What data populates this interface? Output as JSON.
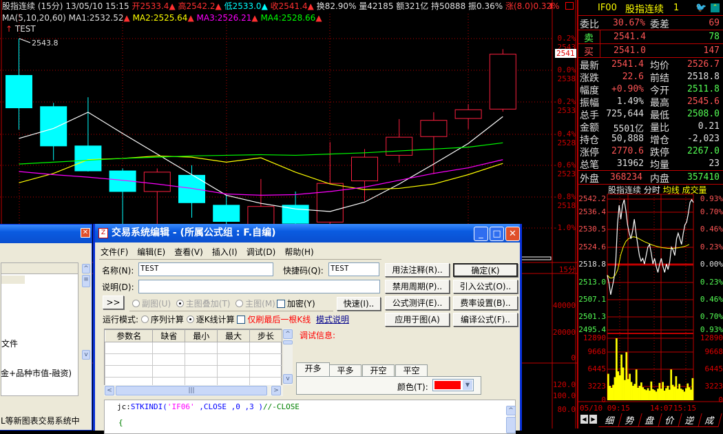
{
  "header": {
    "instrument": "股指连续",
    "period": "(15分)",
    "datetime": "13/05/10 15:15",
    "open": "开2533.4",
    "high": "高2542.2",
    "low": "低2533.0",
    "close": "收2541.4",
    "turnover": "换82.90%",
    "volume": "量42185",
    "amount": "额321亿",
    "open_interest": "持50888",
    "amplitude": "振0.36%",
    "change": "涨(8.0)0.32%"
  },
  "ma": {
    "label": "MA(5,10,20,60)",
    "ma1": "MA1:2532.52",
    "ma2": "MA2:2525.64",
    "ma3": "MA3:2526.21",
    "ma4": "MA4:2528.66"
  },
  "indicator_label": "TEST",
  "high_marker": "2543.8",
  "price_axis": [
    {
      "pct": "0.2%",
      "price": "2543"
    },
    {
      "pct": "0.0%",
      "price": "2538"
    },
    {
      "pct": "-0.2%",
      "price": "2533"
    },
    {
      "pct": "-0.4%",
      "price": "2528"
    },
    {
      "pct": "-0.6%",
      "price": "2523"
    },
    {
      "pct": "-0.8%",
      "price": "2518"
    },
    {
      "pct": "-1.0%",
      "price": ""
    }
  ],
  "current_price_tag": "2541",
  "period_label": "15分",
  "volume_axis": [
    "40000",
    "20000",
    "0"
  ],
  "sub_axis": [
    "120.0",
    "100.0",
    "80.0"
  ],
  "colors": {
    "up": "#ff2040",
    "down": "#00ffff",
    "ma1": "#ffffff",
    "ma2": "#ffff00",
    "ma3": "#ff00ff",
    "ma4": "#00ff00",
    "grid": "#c00000"
  },
  "chart_data": {
    "type": "candlestick",
    "candles": [
      {
        "o": 2537.9,
        "h": 2543.8,
        "l": 2529.2,
        "c": 2532.7
      },
      {
        "o": 2532.9,
        "h": 2533.5,
        "l": 2524.3,
        "c": 2526.6
      },
      {
        "o": 2526.6,
        "h": 2534.4,
        "l": 2522.5,
        "c": 2522.6
      },
      {
        "o": 2522.6,
        "h": 2523.0,
        "l": 2512.0,
        "c": 2519.3
      },
      {
        "o": 2519.3,
        "h": 2523.0,
        "l": 2512.0,
        "c": 2522.4
      },
      {
        "o": 2521.9,
        "h": 2523.5,
        "l": 2515.1,
        "c": 2517.5
      },
      {
        "o": 2517.1,
        "h": 2518.7,
        "l": 2512.0,
        "c": 2514.5
      },
      {
        "o": 2514.0,
        "h": 2521.3,
        "l": 2512.0,
        "c": 2516.9
      },
      {
        "o": 2517.1,
        "h": 2519.3,
        "l": 2513.0,
        "c": 2514.2
      },
      {
        "o": 2514.4,
        "h": 2527.2,
        "l": 2512.0,
        "c": 2520.6
      },
      {
        "o": 2521.0,
        "h": 2526.1,
        "l": 2517.8,
        "c": 2524.8
      },
      {
        "o": 2525.1,
        "h": 2530.9,
        "l": 2523.9,
        "c": 2528.0
      },
      {
        "o": 2528.1,
        "h": 2532.0,
        "l": 2522.1,
        "c": 2530.7
      },
      {
        "o": 2531.0,
        "h": 2533.3,
        "l": 2529.3,
        "c": 2532.4
      },
      {
        "o": 2532.5,
        "h": 2542.1,
        "l": 2532.1,
        "c": 2541.3
      }
    ],
    "ma1": [
      2527.8,
      2529.4,
      2532.0,
      2528.6,
      2525.3,
      2522.0,
      2518.7,
      2517.4,
      2516.5,
      2516.1,
      2517.6,
      2520.5,
      2523.7,
      2527.0,
      2531.3
    ],
    "ma2": [
      2520.7,
      2522.2,
      2524.4,
      2524.6,
      2525.0,
      2524.8,
      2524.0,
      2524.7,
      2522.4,
      2520.5,
      2519.6,
      2519.8,
      2520.5,
      2522.0,
      2523.8
    ],
    "ma3": [
      2522.5,
      2522.0,
      2521.6,
      2521.1,
      2520.5,
      2519.8,
      2518.9,
      2518.7,
      2518.8,
      2519.3,
      2520.0,
      2521.1,
      2522.2,
      2523.1,
      2524.4
    ],
    "ma4": [
      2523.7,
      2524.0,
      2524.3,
      2524.6,
      2524.8,
      2525.0,
      2525.1,
      2525.2,
      2525.1,
      2525.3,
      2525.5,
      2525.8,
      2526.1,
      2526.4,
      2527.1
    ]
  },
  "quote": {
    "code": "IF00",
    "name": "股指连续",
    "num": "1",
    "wb_label": "委比",
    "wb": "30.67%",
    "wc_label": "委差",
    "wc": "69",
    "sell_label": "卖",
    "sell_price": "2541.4",
    "sell_vol": "78",
    "buy_label": "买",
    "buy_price": "2541.0",
    "buy_vol": "147",
    "rows": [
      {
        "l1": "最新",
        "v1": "2541.4",
        "c1": "#ff5555",
        "l2": "均价",
        "v2": "2526.7",
        "c2": "#ff5555"
      },
      {
        "l1": "涨跌",
        "v1": "22.6",
        "c1": "#ff5555",
        "l2": "前结",
        "v2": "2518.8",
        "c2": "#e0e0e0"
      },
      {
        "l1": "幅度",
        "v1": "+0.90%",
        "c1": "#ff5555",
        "l2": "今开",
        "v2": "2511.8",
        "c2": "#55ff55"
      },
      {
        "l1": "振幅",
        "v1": "1.49%",
        "c1": "#e0e0e0",
        "l2": "最高",
        "v2": "2545.6",
        "c2": "#ff5555"
      },
      {
        "l1": "总手",
        "v1": "725,644",
        "c1": "#e0e0e0",
        "l2": "最低",
        "v2": "2508.0",
        "c2": "#55ff55"
      },
      {
        "l1": "金额",
        "v1": "5501亿",
        "c1": "#e0e0e0",
        "l2": "量比",
        "v2": "0.21",
        "c2": "#e0e0e0"
      },
      {
        "l1": "持仓",
        "v1": "50,888",
        "c1": "#e0e0e0",
        "l2": "增仓",
        "v2": "-2,023",
        "c2": "#e0e0e0"
      },
      {
        "l1": "涨停",
        "v1": "2770.6",
        "c1": "#ff5555",
        "l2": "跌停",
        "v2": "2267.0",
        "c2": "#55ff55"
      },
      {
        "l1": "总笔",
        "v1": "31962",
        "c1": "#e0e0e0",
        "l2": "均量",
        "v2": "23",
        "c2": "#e0e0e0"
      }
    ],
    "outer_label": "外盘",
    "outer": "368234",
    "inner_label": "内盘",
    "inner": "357410"
  },
  "mini": {
    "title": "股指连续",
    "t1": "分时",
    "t2": "均线",
    "t3": "成交量",
    "left_axis": [
      "2542.2",
      "2536.4",
      "2530.5",
      "2524.6",
      "2518.8",
      "2513.0",
      "2507.1",
      "2501.3",
      "2495.4"
    ],
    "right_axis": [
      "0.93%",
      "0.70%",
      "0.46%",
      "0.23%",
      "0.00%",
      "0.23%",
      "0.46%",
      "0.70%",
      "0.93%"
    ],
    "vol_axis": [
      "12890",
      "9668",
      "6445",
      "3223",
      "0"
    ],
    "time_start": "05/10 09:15",
    "time_mid": "14:07",
    "time_end": "15:15",
    "tabs": [
      "细",
      "势",
      "盘",
      "价",
      "逆",
      "成"
    ],
    "chart_data": {
      "type": "line",
      "price": [
        2515,
        2512,
        2508,
        2511,
        2514,
        2520,
        2533,
        2540,
        2535,
        2540,
        2542,
        2538,
        2533,
        2530,
        2528,
        2531,
        2535,
        2530,
        2526,
        2522,
        2520,
        2521,
        2519,
        2522,
        2525,
        2526,
        2523,
        2519,
        2521,
        2518,
        2516,
        2519,
        2521,
        2518,
        2516,
        2519,
        2517,
        2520,
        2525,
        2524,
        2522,
        2528,
        2530,
        2528,
        2526,
        2530,
        2533,
        2534,
        2537,
        2541,
        2542,
        2541
      ],
      "avg": [
        2515,
        2514,
        2514,
        2515,
        2517,
        2522,
        2525,
        2527,
        2528,
        2528.5,
        2528.7,
        2528.5,
        2528,
        2527.5,
        2527,
        2526.6,
        2526.2,
        2525.8,
        2525.5,
        2525.2,
        2525,
        2524.8,
        2524.7,
        2524.6,
        2524.6,
        2524.6,
        2524.7,
        2524.8,
        2525,
        2525.2,
        2525.5,
        2526
      ],
      "volume": [
        5500,
        3000,
        2600,
        3200,
        4800,
        12890,
        6000,
        5200,
        9500,
        6800,
        4200,
        10000,
        4400,
        5500,
        3800,
        3000,
        3400,
        6400,
        2600,
        3000,
        3700,
        2700,
        2300,
        2100,
        2500,
        2000,
        3900,
        2300,
        2100,
        1800,
        2400,
        3600,
        2400,
        3800,
        2000,
        2500,
        3000,
        2200,
        6400,
        3200,
        2800,
        5000,
        2400,
        3400,
        2400,
        2200,
        1800,
        2500,
        3500,
        2700,
        2200,
        4600
      ],
      "ylim": [
        2495.4,
        2542.2
      ],
      "vol_max": 12890
    }
  },
  "dialog": {
    "title": "交易系统编辑 - (所属公式组 : F.自编)",
    "menu": [
      "文件(F)",
      "编辑(E)",
      "查看(V)",
      "插入(I)",
      "调试(D)",
      "帮助(H)"
    ],
    "name_label": "名称(N):",
    "name_value": "TEST",
    "shortcut_label": "快捷码(Q):",
    "shortcut_value": "TEST",
    "desc_label": "说明(D):",
    "desc_value": "",
    "expand": ">>",
    "radio_sub": "副图(U)",
    "radio_overlay": "主图叠加(T)",
    "radio_main": "主图(M)",
    "encrypt": "加密(Y)",
    "quick": "快速(I)..",
    "run_mode_label": "运行模式:",
    "mode_seq": "序列计算",
    "mode_bar": "逐K线计算",
    "refresh_last": "仅刷最后一根K线",
    "mode_help": "模式说明",
    "buttons": [
      "用法注释(R)..",
      "确定(K)",
      "禁用周期(P)..",
      "引入公式(O)..",
      "公式测评(E)..",
      "费率设置(B)..",
      "应用于图(A)",
      "编译公式(F).."
    ],
    "param_headers": [
      "参数名",
      "缺省",
      "最小",
      "最大",
      "步长"
    ],
    "debug_label": "调试信息:",
    "tabs": [
      "开多",
      "平多",
      "开空",
      "平空"
    ],
    "color_label": "颜色(T):",
    "color_value": "#ff0000",
    "code": {
      "var": "jc:",
      "func": "STKINDI(",
      "str": "'IF06'",
      "args": " ,CLOSE ,0 ,3  )",
      "comment": "//-CLOSE",
      "line2": "{"
    }
  },
  "left_window": {
    "text1": "文件",
    "text2": "金+品种市值-融资)",
    "text3": "L等新图表交易系统中"
  }
}
